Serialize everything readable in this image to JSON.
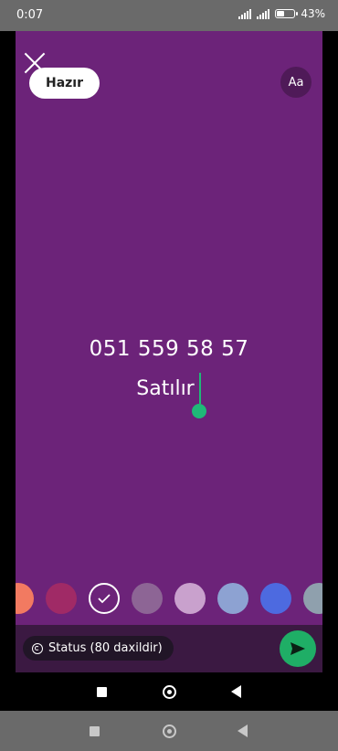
{
  "status_bar": {
    "time": "0:07",
    "battery_percent": "43",
    "battery_level": 0.43
  },
  "editor": {
    "done_label": "Hazır",
    "font_button_label": "Aa",
    "text_line1": "051 559 58 57",
    "text_line2": "Satılır",
    "background_color": "#6c2379"
  },
  "colors": [
    "#f27a61",
    "#a02a66",
    "#6c2379",
    "#8d6595",
    "#c9a1cd",
    "#8da2d2",
    "#4d6ae0",
    "#8fa0ad"
  ],
  "selected_color_index": 2,
  "composer": {
    "audience_label": "Status (80 daxildir)"
  },
  "accent_color": "#1fae66",
  "icons": {
    "close": "close-icon",
    "audience": "status-privacy-icon",
    "send": "send-icon"
  }
}
